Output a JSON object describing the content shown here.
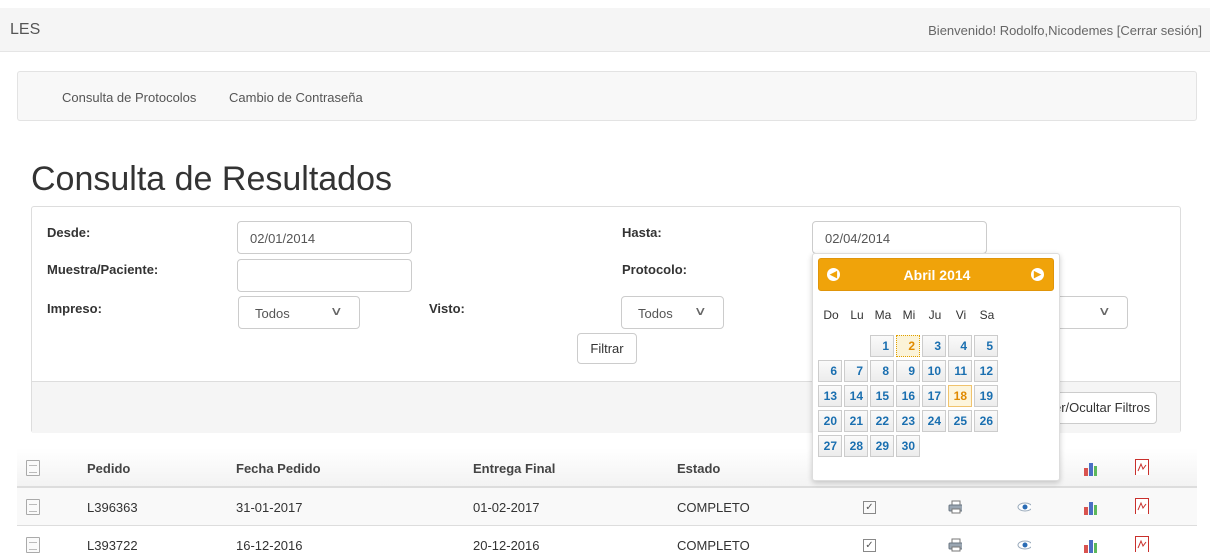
{
  "header": {
    "brand": "LES",
    "welcome": "Bienvenido! Rodolfo,Nicodemes [Cerrar sesión]"
  },
  "nav": {
    "items": [
      "Consulta de Protocolos",
      "Cambio de Contraseña"
    ]
  },
  "page_title": "Consulta de Resultados",
  "filters": {
    "desde_label": "Desde:",
    "desde_value": "02/01/2014",
    "hasta_label": "Hasta:",
    "hasta_value": "02/04/2014",
    "muestra_label": "Muestra/Paciente:",
    "muestra_value": "",
    "protocolo_label": "Protocolo:",
    "impreso_label": "Impreso:",
    "impreso_value": "Todos",
    "visto_label": "Visto:",
    "visto_value": "Todos",
    "filtrar_label": "Filtrar",
    "toggle_label": "er/Ocultar Filtros"
  },
  "calendar": {
    "month_label": "Abril 2014",
    "weekdays": [
      "Do",
      "Lu",
      "Ma",
      "Mi",
      "Ju",
      "Vi",
      "Sa"
    ],
    "weeks": [
      [
        "",
        "",
        "1",
        "2",
        "3",
        "4",
        "5"
      ],
      [
        "6",
        "7",
        "8",
        "9",
        "10",
        "11",
        "12"
      ],
      [
        "13",
        "14",
        "15",
        "16",
        "17",
        "18",
        "19"
      ],
      [
        "20",
        "21",
        "22",
        "23",
        "24",
        "25",
        "26"
      ],
      [
        "27",
        "28",
        "29",
        "30",
        "",
        "",
        ""
      ]
    ],
    "highlighted_day": "2",
    "today_day": "18",
    "accent_color": "#f0a30a",
    "day_color": "#1a6fb0"
  },
  "table": {
    "columns": [
      "Pedido",
      "Fecha Pedido",
      "Entrega Final",
      "Estado"
    ],
    "rows": [
      {
        "pedido": "L396363",
        "fecha": "31-01-2017",
        "entrega": "01-02-2017",
        "estado": "COMPLETO"
      },
      {
        "pedido": "L393722",
        "fecha": "16-12-2016",
        "entrega": "20-12-2016",
        "estado": "COMPLETO"
      }
    ],
    "row_icons": [
      "document-icon",
      "checkbox-icon",
      "print-icon",
      "eye-icon",
      "bar-chart-icon",
      "pdf-icon"
    ]
  }
}
